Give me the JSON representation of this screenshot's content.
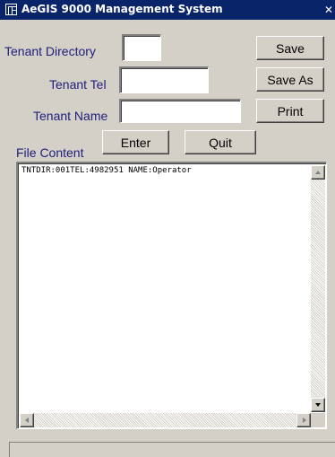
{
  "window": {
    "title": "AeGIS 9000 Management System",
    "close_glyph": "✕"
  },
  "form": {
    "tenant_directory_label": "Tenant Directory",
    "tenant_directory_value": "",
    "tenant_tel_label": "Tenant Tel",
    "tenant_tel_value": "",
    "tenant_name_label": "Tenant Name",
    "tenant_name_value": "",
    "file_content_label": "File Content"
  },
  "buttons": {
    "save": "Save",
    "save_as": "Save As",
    "print": "Print",
    "enter": "Enter",
    "quit": "Quit"
  },
  "file_content": {
    "text": "TNTDIR:001TEL:4982951 NAME:Operator"
  },
  "icons": [
    "app-icon",
    "close-icon",
    "scroll-up-icon",
    "scroll-down-icon",
    "scroll-left-icon",
    "scroll-right-icon"
  ],
  "colors": {
    "titlebar": "#0a246a",
    "label_text": "#20207a",
    "face": "#d4d0c8"
  }
}
